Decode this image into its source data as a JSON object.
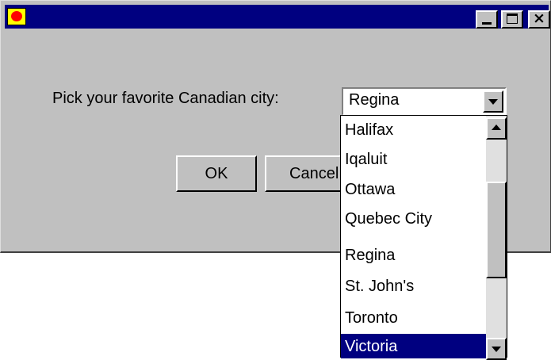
{
  "window": {
    "title": "",
    "icon": "java-coffee-cup-icon",
    "controls": {
      "minimize": "minimize-icon",
      "maximize": "maximize-icon",
      "close": "×"
    },
    "colors": {
      "titlebar": "#000080",
      "face": "#c0c0c0",
      "selection": "#000080"
    }
  },
  "form": {
    "prompt": "Pick your favorite Canadian city:",
    "combo": {
      "selected_value": "Regina",
      "arrow_icon": "chevron-down-icon"
    }
  },
  "dropdown": {
    "items": [
      {
        "label": "Halifax",
        "selected": false
      },
      {
        "label": "Iqaluit",
        "selected": false
      },
      {
        "label": "Ottawa",
        "selected": false
      },
      {
        "label": "Quebec City",
        "selected": false
      },
      {
        "label": "Regina",
        "selected": false
      },
      {
        "label": "St. John's",
        "selected": false
      },
      {
        "label": "Toronto",
        "selected": false
      },
      {
        "label": "Victoria",
        "selected": true
      }
    ],
    "scrollbar": {
      "up_icon": "arrow-up-icon",
      "down_icon": "arrow-down-icon"
    }
  },
  "buttons": {
    "ok": "OK",
    "cancel": "Cancel"
  }
}
